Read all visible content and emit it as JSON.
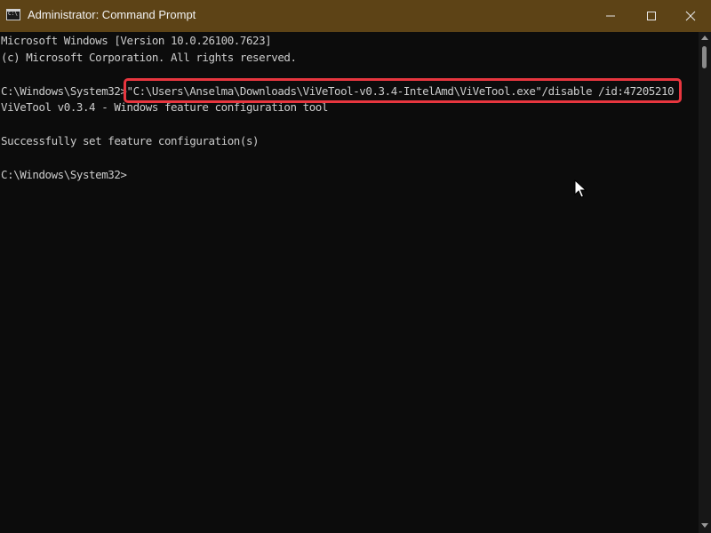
{
  "window": {
    "title": "Administrator: Command Prompt",
    "icon": "cmd-icon",
    "icon_glyph": "C:\\",
    "controls": [
      "minimize-icon",
      "maximize-icon",
      "close-icon"
    ],
    "colors": {
      "titlebar": "#5d4316",
      "console_bg": "#0c0c0c",
      "text": "#cccccc",
      "highlight_border": "#e8363f"
    }
  },
  "console": {
    "lines": [
      "Microsoft Windows [Version 10.0.26100.7623]",
      "(c) Microsoft Corporation. All rights reserved.",
      "",
      "C:\\Windows\\System32>\"C:\\Users\\Anselma\\Downloads\\ViVeTool-v0.3.4-IntelAmd\\ViVeTool.exe\"/disable /id:47205210",
      "ViVeTool v0.3.4 - Windows feature configuration tool",
      "",
      "Successfully set feature configuration(s)",
      "",
      "C:\\Windows\\System32>"
    ],
    "highlighted_command": "\"C:\\Users\\Anselma\\Downloads\\ViVeTool-v0.3.4-IntelAmd\\ViVeTool.exe\"/disable /id:47205210"
  }
}
